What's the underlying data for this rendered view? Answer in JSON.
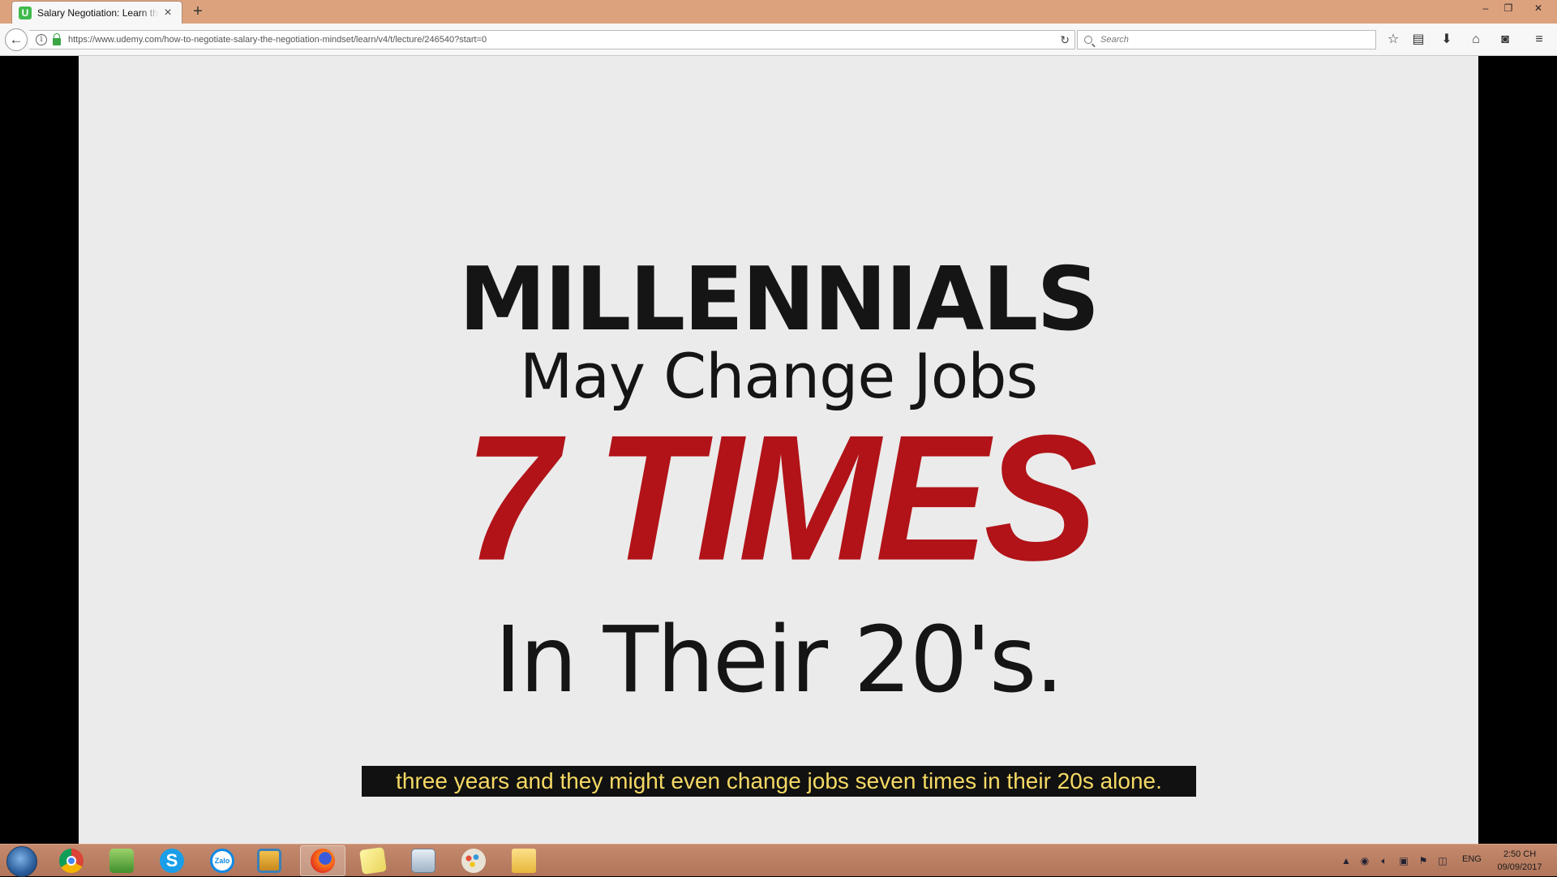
{
  "browser": {
    "tab_title": "Salary Negotiation: Learn the",
    "tab_favicon": "U",
    "new_tab_label": "+",
    "url": "https://www.udemy.com/how-to-negotiate-salary-the-negotiation-mindset/learn/v4/t/lecture/246540?start=0",
    "search_placeholder": "Search",
    "icons": [
      "back-icon",
      "info-icon",
      "lock-icon",
      "reload-icon",
      "search-icon",
      "bookmark-star-icon",
      "reading-list-icon",
      "download-icon",
      "home-icon",
      "pocket-icon",
      "menu-icon"
    ]
  },
  "video": {
    "line1": "MILLENNIALS",
    "line2": "May Change Jobs",
    "line3": "7 TIMES",
    "line4": "In Their 20's.",
    "subtitle": "three years and they might even change jobs seven times in their 20s alone.",
    "accent_color": "#b11318",
    "subtitle_color": "#f5d964"
  },
  "taskbar": {
    "apps": [
      "start-orb",
      "chrome",
      "notepad",
      "skype",
      "zalo",
      "photo-viewer",
      "firefox",
      "sticky-notes",
      "network-monitor",
      "paint",
      "file-explorer"
    ],
    "language": "ENG",
    "time": "2:50 CH",
    "date": "09/09/2017"
  }
}
